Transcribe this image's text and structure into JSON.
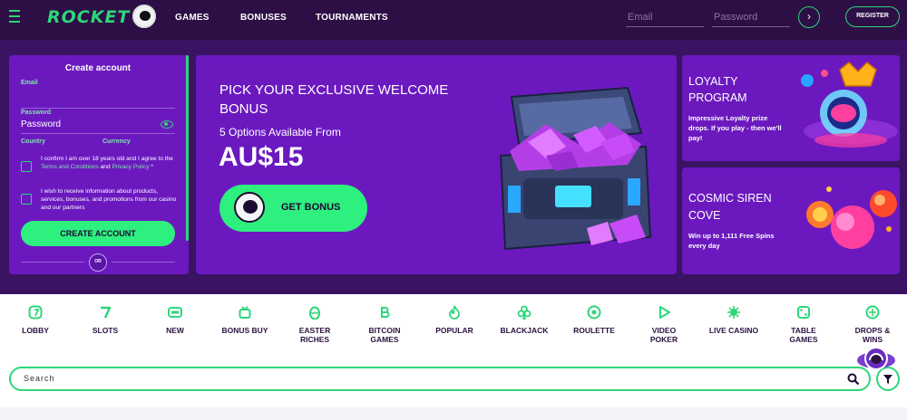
{
  "header": {
    "logo_text": "ROCKET",
    "nav": [
      "GAMES",
      "BONUSES",
      "TOURNAMENTS"
    ],
    "email_placeholder": "Email",
    "password_placeholder": "Password",
    "go_icon": "chevron-right-icon",
    "register_label": "REGISTER"
  },
  "account": {
    "title": "Create account",
    "email_label": "Email",
    "password_label": "Password",
    "password_placeholder": "Password",
    "country_label": "Country",
    "currency_label": "Currency",
    "consent_pre": "I confirm I am over 18 years old and I agree to the",
    "consent_terms": "Terms and Conditions",
    "consent_and": "and",
    "consent_privacy": "Privacy Policy",
    "consent_star": "*",
    "marketing": "I wish to receive information about products, services, bonuses, and promotions from our casino and our partners",
    "create_label": "CREATE ACCOUNT",
    "or_label": "OR"
  },
  "hero": {
    "title": "PICK YOUR EXCLUSIVE WELCOME BONUS",
    "subtitle": "5 Options Available From",
    "amount": "AU$15",
    "button": "GET BONUS"
  },
  "cards": [
    {
      "title_l1": "LOYALTY",
      "title_l2": "PROGRAM",
      "text_l1": "Impressive Loyalty prize",
      "text_l2": "drops. If you play - then we'll",
      "text_l3": "pay!"
    },
    {
      "title_l1": "COSMIC SIREN",
      "title_l2": "COVE",
      "text_l1": "Win up to 1,111 Free Spins",
      "text_l2": "every day"
    }
  ],
  "categories": [
    {
      "l1": "LOBBY",
      "l2": "",
      "icon": "lobby-icon"
    },
    {
      "l1": "SLOTS",
      "l2": "",
      "icon": "seven-icon"
    },
    {
      "l1": "NEW",
      "l2": "",
      "icon": "new-icon"
    },
    {
      "l1": "BONUS BUY",
      "l2": "",
      "icon": "gift-icon"
    },
    {
      "l1": "EASTER",
      "l2": "RICHES",
      "icon": "egg-icon"
    },
    {
      "l1": "BITCOIN",
      "l2": "GAMES",
      "icon": "bitcoin-icon"
    },
    {
      "l1": "POPULAR",
      "l2": "",
      "icon": "flame-icon"
    },
    {
      "l1": "BLACKJACK",
      "l2": "",
      "icon": "club-icon"
    },
    {
      "l1": "ROULETTE",
      "l2": "",
      "icon": "roulette-icon"
    },
    {
      "l1": "VIDEO",
      "l2": "POKER",
      "icon": "play-icon"
    },
    {
      "l1": "LIVE CASINO",
      "l2": "",
      "icon": "live-icon"
    },
    {
      "l1": "TABLE",
      "l2": "GAMES",
      "icon": "dice-icon"
    },
    {
      "l1": "DROPS &",
      "l2": "WINS",
      "icon": "drops-icon"
    }
  ],
  "search": {
    "placeholder": "Search",
    "search_icon": "search-icon",
    "filter_icon": "filter-icon"
  },
  "colors": {
    "accent": "#2dd67a",
    "panel": "#6b19bf",
    "header": "#2d0f45",
    "button_text": "#1d0a33"
  }
}
